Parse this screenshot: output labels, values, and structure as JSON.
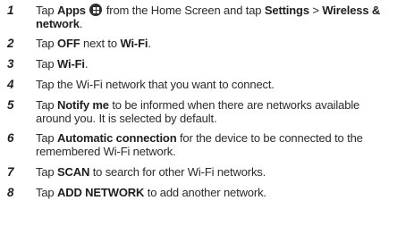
{
  "steps": [
    {
      "number": "1",
      "line1": {
        "a": "Tap ",
        "b": "Apps",
        "c": " from the Home Screen and tap ",
        "d": "Settings",
        "e": " > ",
        "f": "Wireless &"
      },
      "line2": {
        "a": "network",
        "b": "."
      }
    },
    {
      "number": "2",
      "line1": {
        "a": "Tap ",
        "b": "OFF",
        "c": " next to ",
        "d": "Wi-Fi",
        "e": "."
      }
    },
    {
      "number": "3",
      "line1": {
        "a": "Tap ",
        "b": "Wi-Fi",
        "c": "."
      }
    },
    {
      "number": "4",
      "line1": {
        "a": "Tap the Wi-Fi network that you want to connect."
      }
    },
    {
      "number": "5",
      "line1": {
        "a": "Tap ",
        "b": "Notify me",
        "c": " to be informed when there are networks available"
      },
      "line2": {
        "a": "around you. It is selected by default."
      }
    },
    {
      "number": "6",
      "line1": {
        "a": "Tap ",
        "b": "Automatic connection",
        "c": " for the device to be connected to the"
      },
      "line2": {
        "a": "remembered Wi-Fi network."
      }
    },
    {
      "number": "7",
      "line1": {
        "a": "Tap ",
        "b": "SCAN",
        "c": " to search for other Wi-Fi networks."
      }
    },
    {
      "number": "8",
      "line1": {
        "a": "Tap ",
        "b": "ADD NETWORK",
        "c": " to add another network."
      }
    }
  ],
  "icons": {
    "apps": "apps-grid-icon"
  }
}
